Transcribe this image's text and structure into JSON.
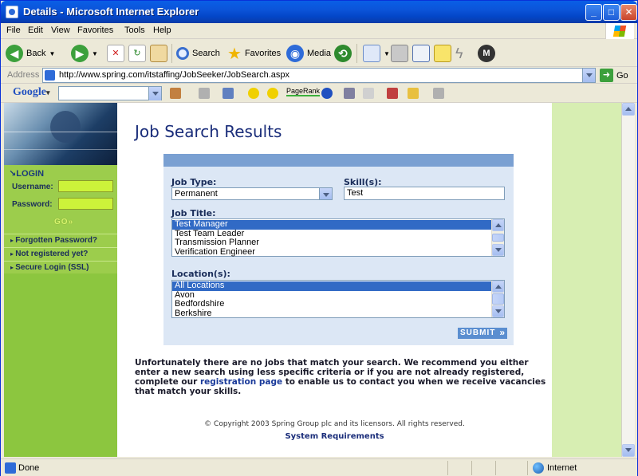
{
  "window": {
    "title": "Details - Microsoft Internet Explorer"
  },
  "menu": [
    "File",
    "Edit",
    "View",
    "Favorites",
    "Tools",
    "Help"
  ],
  "toolbar": {
    "back": "Back",
    "search": "Search",
    "favorites": "Favorites",
    "media": "Media"
  },
  "address": {
    "label": "Address",
    "url": "http://www.spring.com/itstaffing/JobSeeker/JobSearch.aspx",
    "go": "Go"
  },
  "googlebar": {
    "logo": "Google",
    "pagerank": "PageRank"
  },
  "sidebar": {
    "login_title": "LOGIN",
    "username_label": "Username:",
    "password_label": "Password:",
    "go_label": "GO",
    "links": [
      "Forgotten Password?",
      "Not registered yet?",
      "Secure Login (SSL)"
    ]
  },
  "page": {
    "title": "Job Search Results",
    "job_type_label": "Job Type:",
    "job_type_value": "Permanent",
    "skills_label": "Skill(s):",
    "skills_value": "Test",
    "job_title_label": "Job Title:",
    "job_titles": [
      "Test Manager",
      "Test Team Leader",
      "Transmission Planner",
      "Verification Engineer"
    ],
    "job_title_selected": 0,
    "location_label": "Location(s):",
    "locations": [
      "All Locations",
      "Avon",
      "Bedfordshire",
      "Berkshire"
    ],
    "location_selected": 0,
    "submit": "SUBMIT",
    "message_before": "Unfortunately there are no jobs that match your search. We recommend you either enter a new search using less specific criteria or if you are not already registered, complete our",
    "message_link": "registration page",
    "message_after": "to enable us to contact you when we receive vacancies that match your skills.",
    "copyright": "© Copyright 2003 Spring Group plc and its licensors. All rights reserved.",
    "system_requirements": "System Requirements"
  },
  "status": {
    "text": "Done",
    "zone": "Internet"
  }
}
